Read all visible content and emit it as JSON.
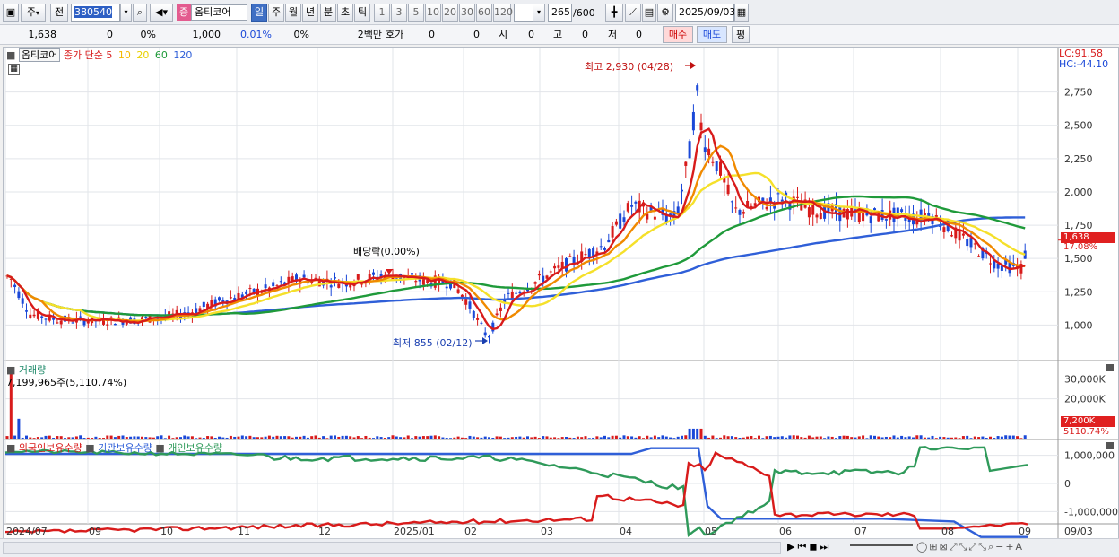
{
  "toolbar": {
    "period_label": "주",
    "prev_label": "전",
    "code": "380540",
    "stock_badge": "증",
    "stock_name": "옵티코어",
    "tabs": [
      "일",
      "주",
      "월",
      "년",
      "분",
      "초",
      "틱"
    ],
    "active_tab": "일",
    "intervals": [
      "1",
      "3",
      "5",
      "10",
      "20",
      "30",
      "60",
      "120"
    ],
    "count": "265",
    "count_total": "/600",
    "date": "2025/09/03"
  },
  "quote": {
    "price": "1,638",
    "change": "0",
    "change_pct": "0%",
    "volume": "1,000",
    "vol_ratio": "0.01%",
    "pct2": "0%",
    "unit": "2백만",
    "hoga_label": "호가",
    "hoga_val": "0",
    "val0": "0",
    "open_label": "시",
    "open_val": "0",
    "high_label": "고",
    "high_val": "0",
    "low_label": "저",
    "low_val": "0",
    "buy_label": "매수",
    "sell_label": "매도",
    "avg_label": "평"
  },
  "price_pane": {
    "legend_name": "옵티코어",
    "legend_ma": "종가 단순",
    "ma_periods": [
      "5",
      "10",
      "20",
      "60",
      "120"
    ],
    "lc": "LC:91.58",
    "hc": "HC:-44.10",
    "y_ticks": [
      "2,750",
      "2,500",
      "2,250",
      "2,000",
      "1,750",
      "1,500",
      "1,250",
      "1,000"
    ],
    "y_ticks_values": [
      2750,
      2500,
      2250,
      2000,
      1750,
      1500,
      1250,
      1000
    ],
    "ymin": 740,
    "ymax": 2990,
    "current_price": "1,638",
    "current_pct": "17.08%",
    "high_annotation": "최고 2,930 (04/28)",
    "low_annotation": "최저 855 (02/12)",
    "dividend_annotation": "배당락(0.00%)"
  },
  "volume_pane": {
    "title": "거래량",
    "info": "7,199,965주(5,110.74%)",
    "y_ticks": [
      "30,000K",
      "20,000K"
    ],
    "y_ticks_values": [
      30000,
      20000
    ],
    "ymax": 37000,
    "current": "7,200K",
    "current_pct": "5110.74%"
  },
  "holdings_pane": {
    "legend": [
      "외국인보유수량",
      "기관보유수량",
      "개인보유수량"
    ],
    "y_ticks": [
      "1,000,000",
      "0",
      "-1,000,000"
    ],
    "y_ticks_values": [
      1000000,
      0,
      -1000000
    ]
  },
  "x_labels": [
    "2024/07",
    "09",
    "10",
    "11",
    "12",
    "2025/01",
    "02",
    "03",
    "04",
    "05",
    "06",
    "07",
    "08",
    "09"
  ],
  "x_label_end": "09/03",
  "colors": {
    "up": "#d81b1b",
    "down": "#1a48d8",
    "ma5": "#d81b1b",
    "ma10": "#f08a00",
    "ma20": "#f5e02a",
    "ma60": "#1f9a3a",
    "ma120": "#2f5fd8",
    "foreign": "#d81b1b",
    "institution": "#2f5fd8",
    "individual": "#2f9a5a"
  },
  "chart_data": {
    "type": "candlestick",
    "series_key_points": [
      {
        "date": "2024/07",
        "close": 1350
      },
      {
        "date": "2024/08",
        "close": 1050
      },
      {
        "date": "2024/09",
        "close": 1030
      },
      {
        "date": "2024/10",
        "close": 1080
      },
      {
        "date": "2024/11",
        "close": 1300
      },
      {
        "date": "2024/12",
        "close": 1350
      },
      {
        "date": "2025/01",
        "close": 1330
      },
      {
        "date": "2025/02/12",
        "close": 900
      },
      {
        "date": "2025/03",
        "close": 1450
      },
      {
        "date": "2025/04",
        "close": 1850
      },
      {
        "date": "2025/04/28",
        "close": 2750
      },
      {
        "date": "2025/05",
        "close": 1900
      },
      {
        "date": "2025/06",
        "close": 1850
      },
      {
        "date": "2025/07",
        "close": 1820
      },
      {
        "date": "2025/08",
        "close": 1450
      },
      {
        "date": "2025/09/03",
        "close": 1638
      }
    ],
    "high": {
      "value": 2930,
      "date": "04/28"
    },
    "low": {
      "value": 855,
      "date": "02/12"
    }
  }
}
